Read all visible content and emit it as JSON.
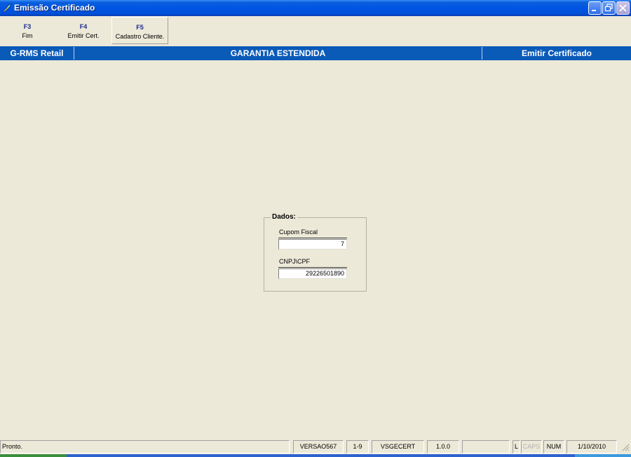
{
  "window": {
    "title": "Emissão Certificado",
    "icon": "app-feather-icon"
  },
  "toolbar": {
    "keys": [
      {
        "key": "F3",
        "label": "Fim"
      },
      {
        "key": "F4",
        "label": "Emitir Cert."
      },
      {
        "key": "F5",
        "label": "Cadastro Cliente."
      }
    ]
  },
  "header": {
    "left": "G-RMS Retail",
    "center": "GARANTIA ESTENDIDA",
    "right": "Emitir Certificado"
  },
  "group": {
    "title": "Dados:",
    "cupom_label": "Cupom Fiscal",
    "cupom_value": "7",
    "cpf_label": "CNPJ\\CPF",
    "cpf_value": "29226501890"
  },
  "status": {
    "message": "Pronto.",
    "version": "VERSAO567",
    "range": "1-9",
    "module": "VSGECERT",
    "build": "1.0.0",
    "empty": "",
    "lock_l": "L",
    "caps": "CAPS",
    "num": "NUM",
    "date": "1/10/2010"
  },
  "colors": {
    "header_bg": "#0A5AB8",
    "titlebar": "#0054E3",
    "window_bg": "#ECE9D8"
  }
}
